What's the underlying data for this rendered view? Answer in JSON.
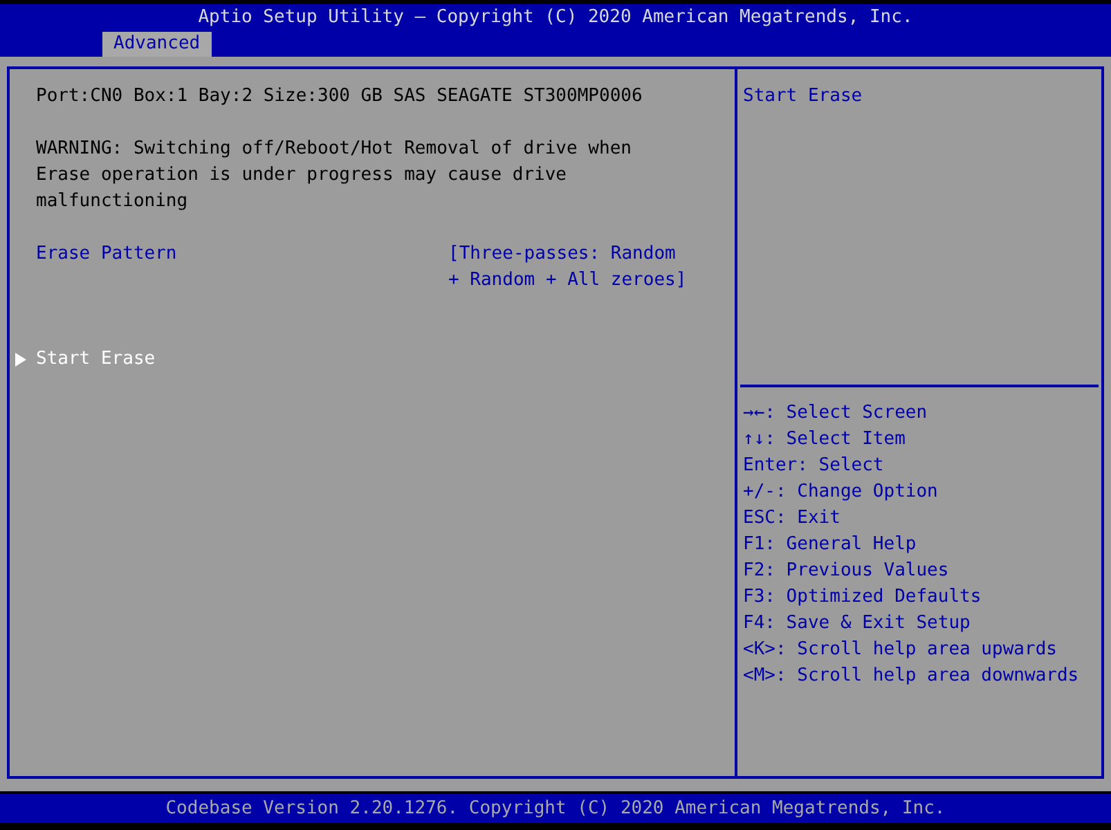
{
  "header": {
    "title": "Aptio Setup Utility – Copyright (C) 2020 American Megatrends, Inc.",
    "tabs": [
      {
        "label": "Advanced",
        "selected": true
      }
    ]
  },
  "main": {
    "items": [
      {
        "kind": "info",
        "text": "Port:CN0 Box:1 Bay:2 Size:300 GB SAS SEAGATE ST300MP0006"
      },
      {
        "kind": "info",
        "text": "WARNING: Switching off/Reboot/Hot Removal of drive when Erase operation is under progress may cause drive malfunctioning"
      },
      {
        "kind": "setting",
        "label": "Erase Pattern",
        "value": "[Three-passes: Random + Random + All zeroes]",
        "selected": false
      },
      {
        "kind": "action",
        "label": "Start Erase",
        "selected": true
      }
    ]
  },
  "help": {
    "text": "Start Erase",
    "keys": [
      "→←: Select Screen",
      "↑↓: Select Item",
      "Enter: Select",
      "+/-: Change Option",
      "ESC: Exit",
      "F1: General Help",
      "F2: Previous Values",
      "F3: Optimized Defaults",
      "F4: Save & Exit Setup",
      "<K>: Scroll help area upwards",
      "<M>: Scroll help area downwards"
    ]
  },
  "footer": {
    "text": "Codebase Version 2.20.1276. Copyright (C) 2020 American Megatrends, Inc."
  }
}
